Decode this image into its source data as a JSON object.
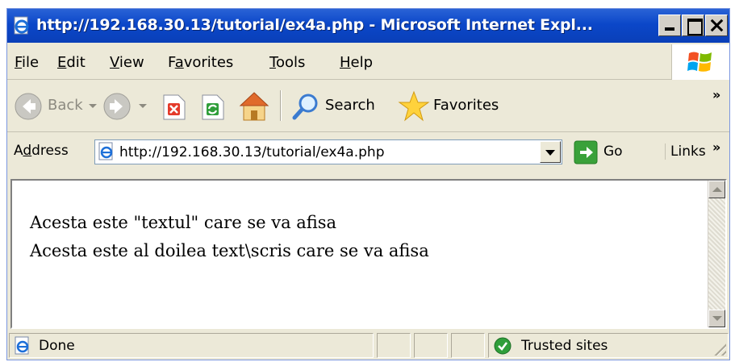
{
  "window": {
    "title": "http://192.168.30.13/tutorial/ex4a.php - Microsoft Internet Expl..."
  },
  "menu": {
    "items": [
      {
        "underline": "F",
        "rest": "ile"
      },
      {
        "underline": "E",
        "rest": "dit"
      },
      {
        "underline": "V",
        "rest": "iew"
      },
      {
        "pre": "F",
        "underline": "a",
        "rest": "vorites"
      },
      {
        "underline": "T",
        "rest": "ools"
      },
      {
        "underline": "H",
        "rest": "elp"
      }
    ]
  },
  "toolbar": {
    "back_label": "Back",
    "search_label": "Search",
    "favorites_label": "Favorites",
    "overflow": "»"
  },
  "address": {
    "label_pre": "A",
    "label_u": "d",
    "label_rest": "dress",
    "url": "http://192.168.30.13/tutorial/ex4a.php",
    "go_label": "Go",
    "links_label": "Links",
    "overflow": "»"
  },
  "content": {
    "lines": [
      "Acesta este \"textul\" care se va afisa",
      "Acesta este al doilea text\\scris care se va afisa"
    ]
  },
  "status": {
    "text": "Done",
    "zone": "Trusted sites"
  },
  "colors": {
    "titlebar": "#0b47c9",
    "chrome": "#ece9d8",
    "go_green": "#3aa13a"
  },
  "icons": [
    "ie-page-icon",
    "minimize-icon",
    "maximize-icon",
    "close-icon",
    "windows-logo-icon",
    "back-arrow-icon",
    "forward-arrow-icon",
    "stop-icon",
    "refresh-icon",
    "home-icon",
    "search-magnifier-icon",
    "favorites-star-icon",
    "go-arrow-icon",
    "trusted-check-icon"
  ]
}
